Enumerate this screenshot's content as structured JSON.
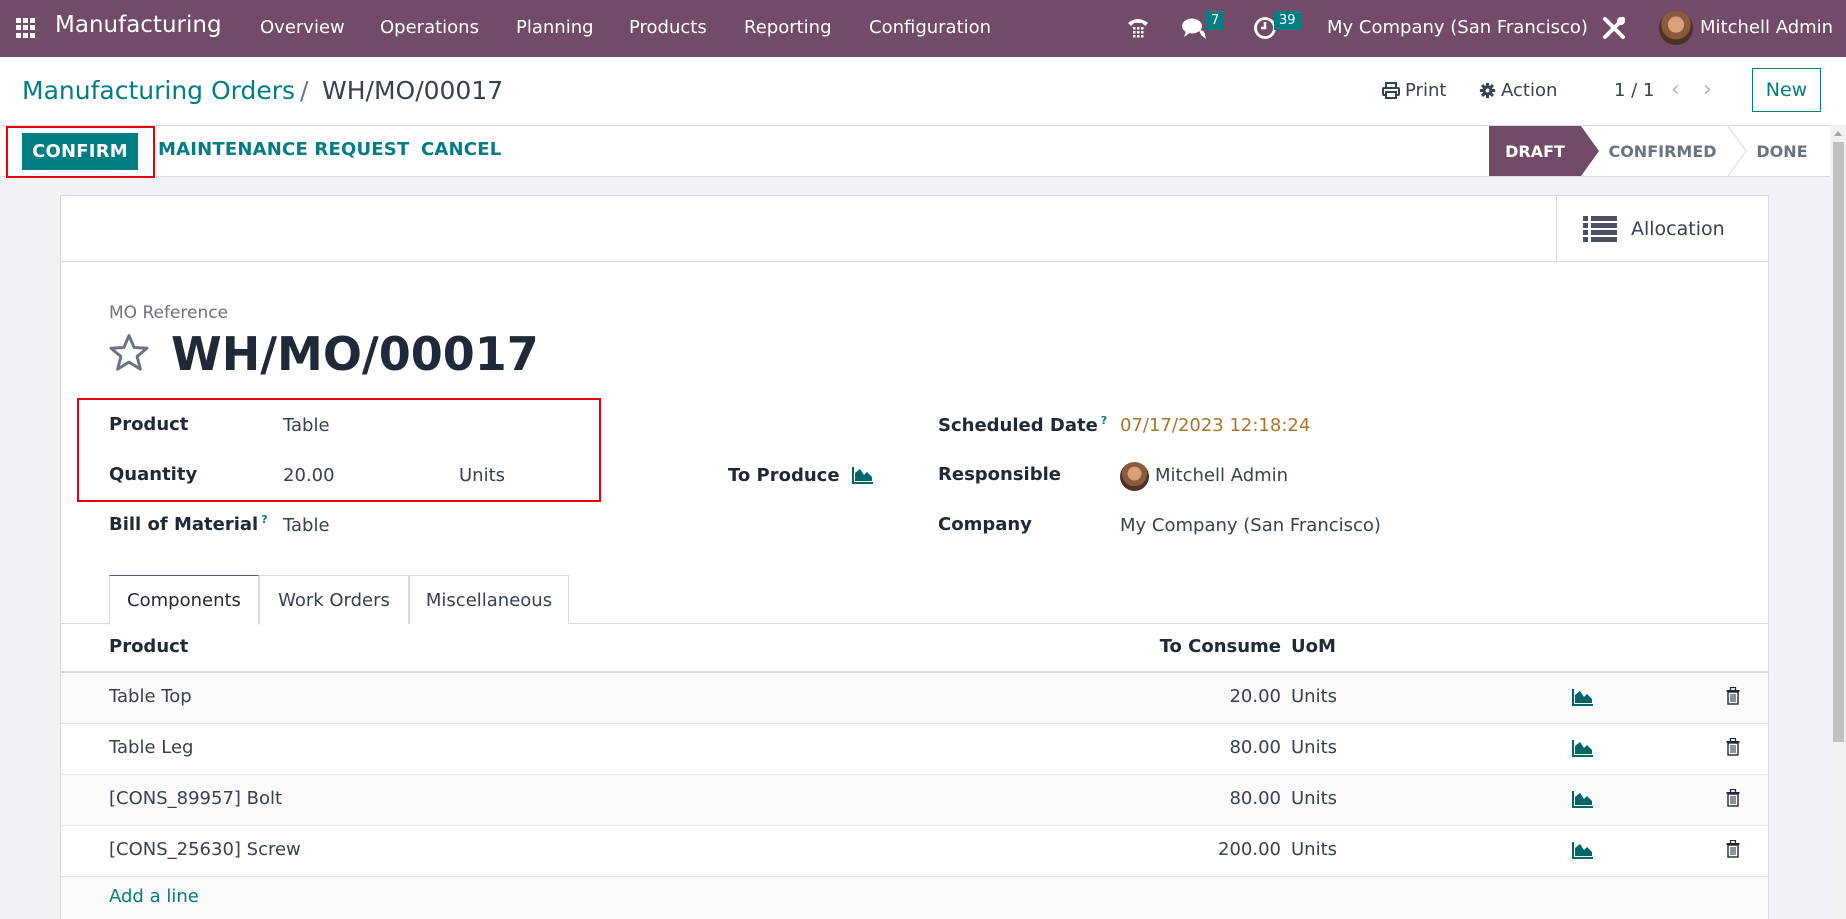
{
  "navbar": {
    "app_name": "Manufacturing",
    "menus": [
      "Overview",
      "Operations",
      "Planning",
      "Products",
      "Reporting",
      "Configuration"
    ],
    "messages_count": "7",
    "activities_count": "39",
    "company": "My Company (San Francisco)",
    "user": "Mitchell Admin"
  },
  "breadcrumb": {
    "parent": "Manufacturing Orders",
    "separator": "/",
    "current": "WH/MO/00017"
  },
  "toolbar": {
    "print_label": "Print",
    "action_label": "Action",
    "pager": "1 / 1",
    "new_label": "New"
  },
  "control_bar": {
    "confirm_label": "CONFIRM",
    "maintenance_label": "MAINTENANCE REQUEST",
    "cancel_label": "CANCEL",
    "stages": [
      "DRAFT",
      "CONFIRMED",
      "DONE"
    ],
    "current_stage": "DRAFT"
  },
  "sheet": {
    "allocation_label": "Allocation",
    "ref_label": "MO Reference",
    "ref_value": "WH/MO/00017",
    "fields": {
      "product_label": "Product",
      "product_value": "Table",
      "quantity_label": "Quantity",
      "quantity_value": "20.00",
      "quantity_uom": "Units",
      "to_produce_label": "To Produce",
      "bom_label": "Bill of Material",
      "bom_value": "Table",
      "scheduled_label": "Scheduled Date",
      "scheduled_value": "07/17/2023 12:18:24",
      "responsible_label": "Responsible",
      "responsible_value": "Mitchell Admin",
      "company_label": "Company",
      "company_value": "My Company (San Francisco)",
      "help_mark": "?"
    },
    "tabs": [
      "Components",
      "Work Orders",
      "Miscellaneous"
    ],
    "active_tab": "Components",
    "table": {
      "headers": {
        "product": "Product",
        "to_consume": "To Consume",
        "uom": "UoM"
      },
      "rows": [
        {
          "product": "Table Top",
          "to_consume": "20.00",
          "uom": "Units"
        },
        {
          "product": "Table Leg",
          "to_consume": "80.00",
          "uom": "Units"
        },
        {
          "product": "[CONS_89957] Bolt",
          "to_consume": "80.00",
          "uom": "Units"
        },
        {
          "product": "[CONS_25630] Screw",
          "to_consume": "200.00",
          "uom": "Units"
        }
      ],
      "add_line_label": "Add a line"
    }
  },
  "colors": {
    "brand": "#714b67",
    "accent": "#017e84",
    "date_warning": "#a8762a",
    "highlight": "#e8000b"
  }
}
